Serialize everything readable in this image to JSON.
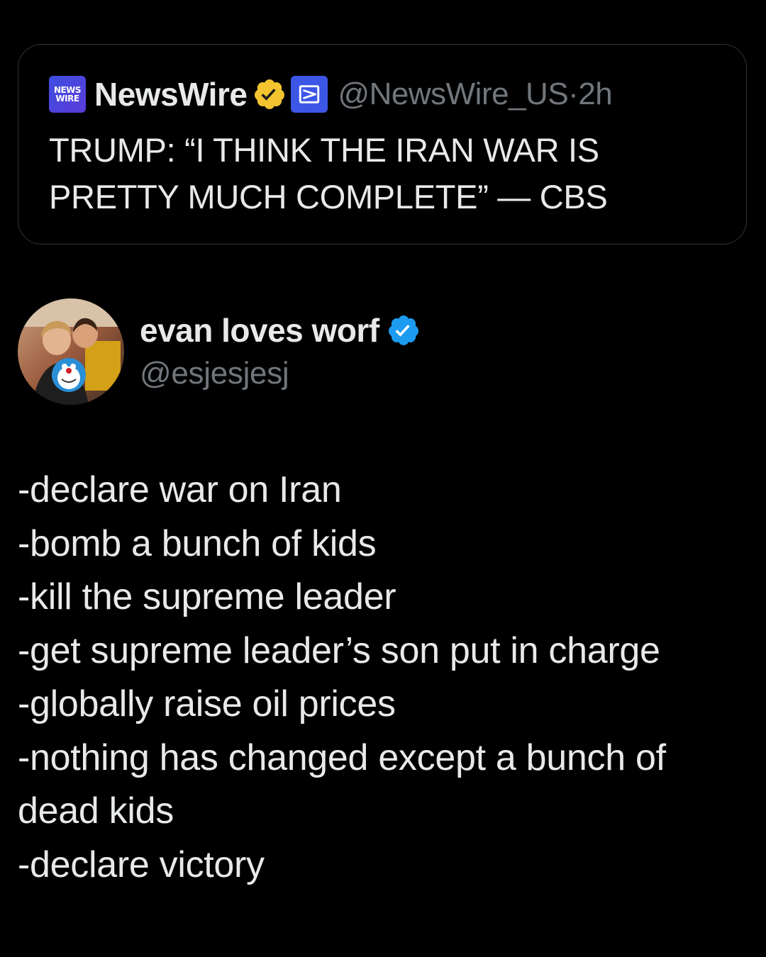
{
  "quote": {
    "logo_line1": "NEWS",
    "logo_line2": "WIRE",
    "name": "NewsWire",
    "handle_time": "@NewsWire_US·2h",
    "text": "TRUMP: “I THINK THE IRAN WAR IS PRETTY MUCH COMPLETE” — CBS",
    "icons": [
      "newswire-logo-icon",
      "gold-verified-badge-icon",
      "affiliate-badge-icon"
    ],
    "colors": {
      "gold_badge": "#f4c430",
      "affiliate_badge": "#3c56e6",
      "logo": "#4a46dd"
    }
  },
  "tweet": {
    "author_name": "evan loves worf",
    "author_handle": "@esjesjesj",
    "icons": [
      "avatar-photo",
      "blue-verified-badge-icon"
    ],
    "colors": {
      "blue_badge": "#1d9bf0"
    },
    "lines": [
      "-declare war on Iran",
      "-bomb a bunch of kids",
      "-kill the supreme leader",
      "-get supreme leader’s son put in charge",
      "-globally raise oil prices",
      "-nothing has changed except a bunch of dead kids",
      "-declare victory"
    ]
  }
}
